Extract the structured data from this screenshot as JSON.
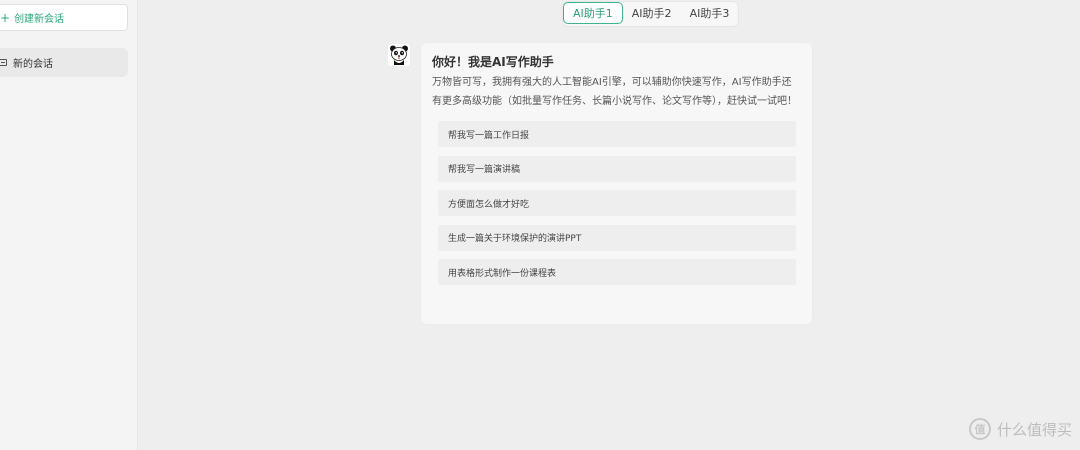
{
  "sidebar": {
    "new_chat_label": "创建新会话",
    "items": [
      {
        "label": "新的会话"
      }
    ]
  },
  "tabs": [
    {
      "label": "AI助手1",
      "active": true
    },
    {
      "label": "AI助手2",
      "active": false
    },
    {
      "label": "AI助手3",
      "active": false
    }
  ],
  "message": {
    "avatar_icon": "panda-avatar-icon",
    "greeting": "你好！我是AI写作助手",
    "intro": "万物皆可写，我拥有强大的人工智能AI引擎，可以辅助你快速写作，AI写作助手还有更多高级功能（如批量写作任务、长篇小说写作、论文写作等），赶快试一试吧！",
    "suggestions": [
      "帮我写一篇工作日报",
      "帮我写一篇演讲稿",
      "方便面怎么做才好吃",
      "生成一篇关于环境保护的演讲PPT",
      "用表格形式制作一份课程表"
    ]
  },
  "watermark": {
    "logo_glyph": "值",
    "text": "什么值得买"
  },
  "colors": {
    "accent": "#2aa57e",
    "active_tab_border": "#3db48c"
  }
}
